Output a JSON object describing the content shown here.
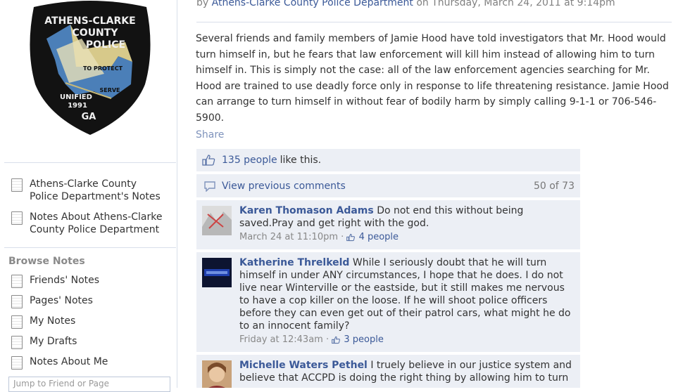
{
  "sidebar": {
    "badge": {
      "line1": "ATHENS-CLARKE",
      "line2": "COUNTY",
      "line3": "POLICE",
      "protect": "TO PROTECT",
      "serve": "SERVE",
      "unified": "UNIFIED",
      "year": "1991",
      "state": "GA"
    },
    "links": [
      {
        "label": "Athens-Clarke County Police Department's Notes"
      },
      {
        "label": "Notes About Athens-Clarke County Police Department"
      }
    ],
    "browse_title": "Browse Notes",
    "browse_items": [
      {
        "label": "Friends' Notes"
      },
      {
        "label": "Pages' Notes"
      },
      {
        "label": "My Notes"
      },
      {
        "label": "My Drafts"
      },
      {
        "label": "Notes About Me"
      }
    ],
    "jump_placeholder": "Jump to Friend or Page"
  },
  "post": {
    "by_prefix": "by",
    "author": "Athens-Clarke County Police Department",
    "date": "on Thursday, March 24, 2011 at 9:14pm",
    "body": "Several friends and family members of Jamie Hood have told investigators that Mr. Hood would turn himself in, but he fears that law enforcement will kill him instead of allowing him to turn himself in.  This is simply not the case:  all of the law enforcement agencies searching for Mr. Hood are trained to use deadly force only in response to life threatening resistance.  Jamie Hood can arrange to turn himself in without fear of bodily harm by simply calling 9-1-1 or 706-546-5900.",
    "share_label": "Share",
    "likes_link": "135 people",
    "likes_suffix": "like this.",
    "view_previous": "View previous comments",
    "comment_count": "50 of 73"
  },
  "comments": [
    {
      "author": "Karen Thomason Adams",
      "text": "Do not end this without being saved.Pray and get right with the god.",
      "time": "March 24 at 11:10pm",
      "likes": "4 people"
    },
    {
      "author": "Katherine Threlkeld",
      "text": "While I seriously doubt that he will turn himself in under ANY circumstances, I hope that he does. I do not live near Winterville or the eastside, but it still makes me nervous to have a cop killer on the loose. If he will shoot police officers before they can even get out of their patrol cars, what might he do to an innocent family?",
      "time": "Friday at 12:43am",
      "likes": "3 people"
    },
    {
      "author": "Michelle Waters Pethel",
      "text": "I truely believe in our justice system and believe that ACCPD is doing the right thing by allowing him to turn",
      "time": "",
      "likes": ""
    }
  ],
  "colors": {
    "link": "#3b5998",
    "comment_bg": "#eceff5",
    "border": "#d8dfea"
  }
}
